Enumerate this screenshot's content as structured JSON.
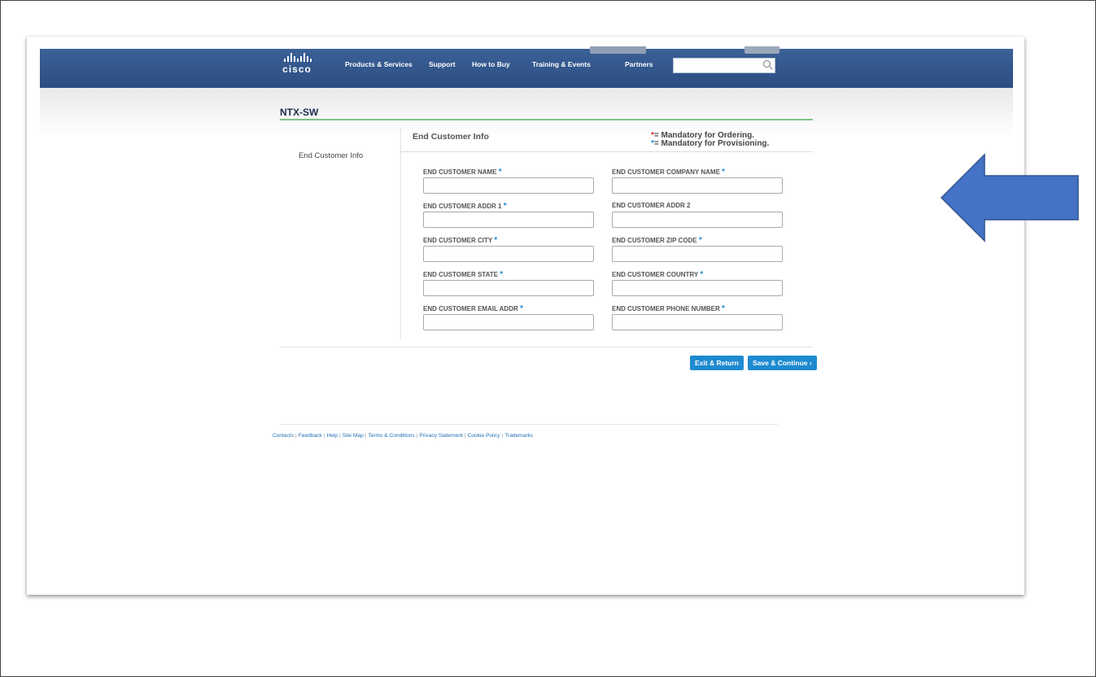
{
  "header": {
    "logo_text": "cisco",
    "nav": [
      "Products & Services",
      "Support",
      "How to Buy",
      "Training & Events",
      "Partners"
    ],
    "search_placeholder": ""
  },
  "page": {
    "title": "NTX-SW",
    "side_nav_item": "End Customer Info",
    "section_title": "End Customer Info",
    "legend_ordering": "= Mandatory for Ordering.",
    "legend_provisioning": "= Mandatory for Provisioning.",
    "legend_star": "*"
  },
  "fields": [
    {
      "label": "END CUSTOMER NAME",
      "required": true,
      "value": ""
    },
    {
      "label": "END CUSTOMER COMPANY NAME",
      "required": true,
      "value": ""
    },
    {
      "label": "END CUSTOMER ADDR 1",
      "required": true,
      "value": ""
    },
    {
      "label": "END CUSTOMER ADDR 2",
      "required": false,
      "value": ""
    },
    {
      "label": "END CUSTOMER CITY",
      "required": true,
      "value": ""
    },
    {
      "label": "END CUSTOMER ZIP CODE",
      "required": true,
      "value": ""
    },
    {
      "label": "END CUSTOMER STATE",
      "required": true,
      "value": ""
    },
    {
      "label": "END CUSTOMER COUNTRY",
      "required": true,
      "value": ""
    },
    {
      "label": "END CUSTOMER EMAIL ADDR",
      "required": true,
      "value": ""
    },
    {
      "label": "END CUSTOMER PHONE NUMBER",
      "required": true,
      "value": ""
    }
  ],
  "buttons": {
    "exit": "Exit & Return",
    "save": "Save & Continue ›"
  },
  "footer": {
    "links": [
      "Contacts",
      "Feedback",
      "Help",
      "Site Map",
      "Terms & Conditions",
      "Privacy Statement",
      "Cookie Policy",
      "Trademarks"
    ]
  },
  "colors": {
    "header_blue": "#2c4d82",
    "accent_blue": "#1e8ad0",
    "title_rule_green": "#7ec585",
    "arrow_blue": "#4472c4"
  }
}
